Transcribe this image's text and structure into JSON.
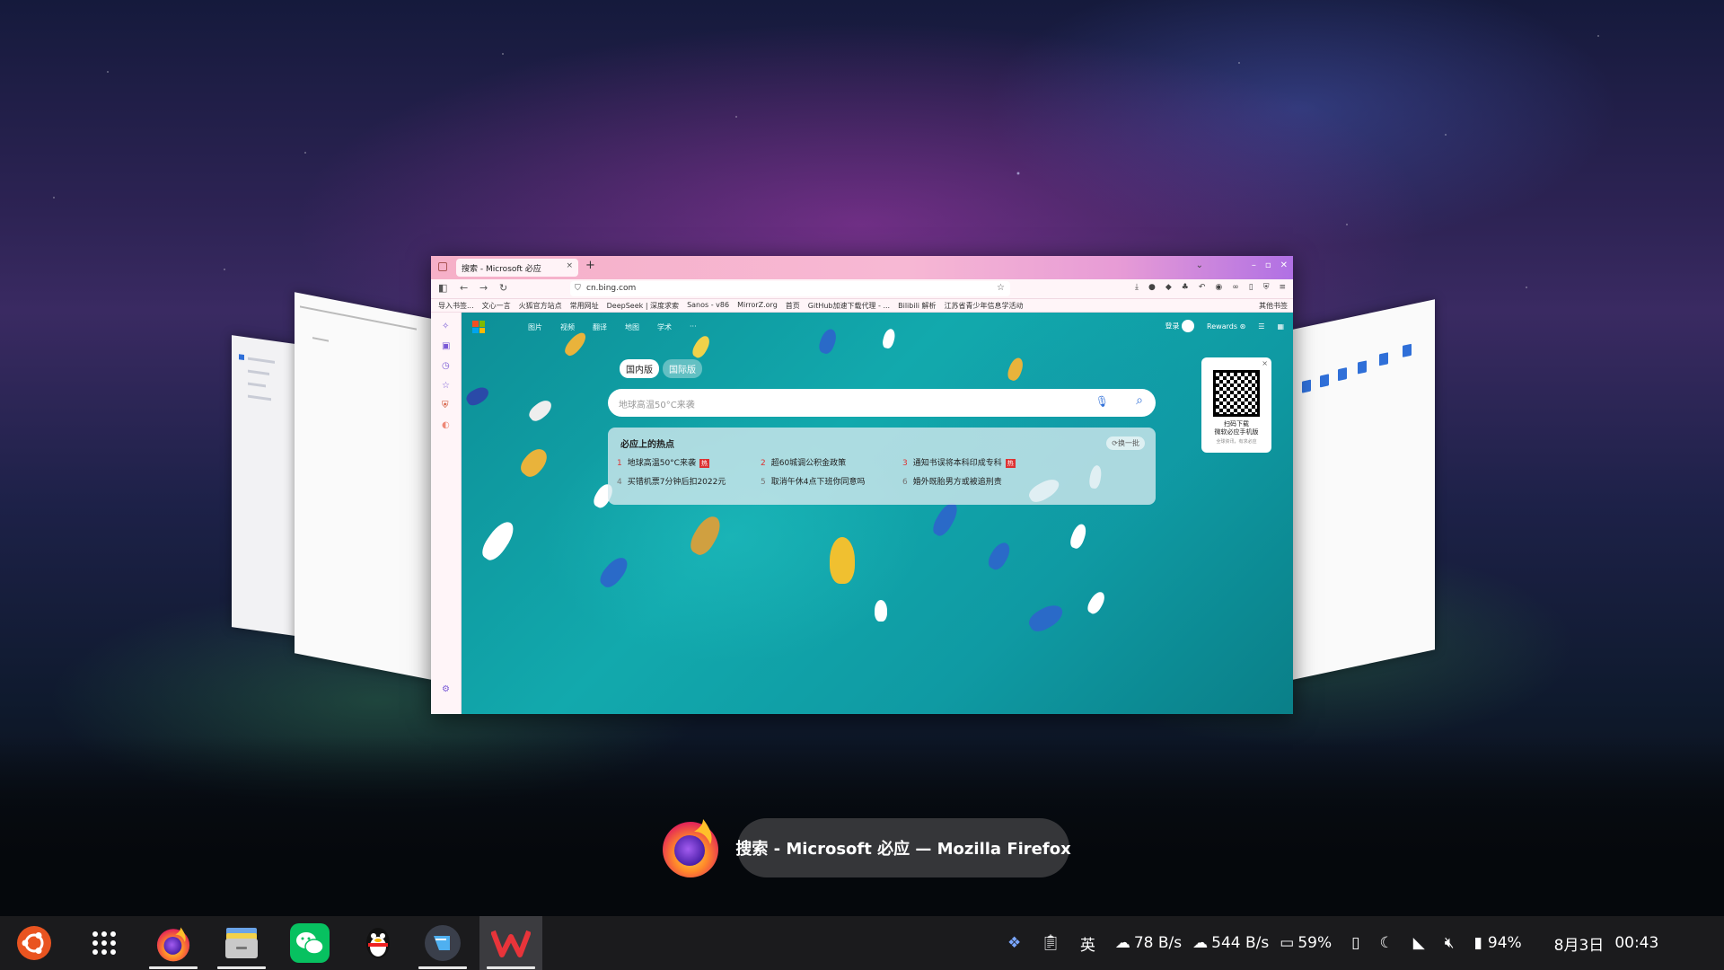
{
  "window_switcher": {
    "title": "搜索 - Microsoft 必应 — Mozilla Firefox",
    "app_icon": "firefox-icon"
  },
  "browser": {
    "tab_title": "搜索 - Microsoft 必应",
    "tab_close": "×",
    "new_tab": "+",
    "url": "cn.bing.com",
    "bookmarks": [
      "导入书签...",
      "文心一言",
      "火狐官方站点",
      "常用网址",
      "DeepSeek | 深度求索",
      "Sanos - v86",
      "MirrorZ.org",
      "首页",
      "GitHub加速下载代理 - ...",
      "Bilibili 解析",
      "江苏省青少年信息学活动"
    ],
    "other_bookmarks": "其他书签"
  },
  "bing": {
    "nav": [
      "图片",
      "视频",
      "翻译",
      "地图",
      "学术",
      "···"
    ],
    "login": "登录",
    "rewards": "Rewards",
    "tabs": [
      "国内版",
      "国际版"
    ],
    "search_placeholder": "地球高温50°C来袭",
    "hot_title": "必应上的热点",
    "refresh": "⟳换一批",
    "hot_items": [
      {
        "num": "1",
        "text": "地球高温50°C来袭",
        "badge": "热"
      },
      {
        "num": "2",
        "text": "超60城调公积金政策",
        "badge": ""
      },
      {
        "num": "3",
        "text": "通知书误将本科印成专科",
        "badge": "热"
      },
      {
        "num": "4",
        "text": "买错机票7分钟后扣2022元",
        "badge": ""
      },
      {
        "num": "5",
        "text": "取消午休4点下班你同意吗",
        "badge": ""
      },
      {
        "num": "6",
        "text": "婚外既胎男方或被追刑责",
        "badge": ""
      }
    ],
    "qr_line1": "扫码下载",
    "qr_line2": "微软必应手机版",
    "qr_line3": "全球资讯，有求必应",
    "qr_close": "×"
  },
  "taskbar": {
    "apps": [
      "ubuntu-logo",
      "app-grid",
      "firefox",
      "files",
      "wechat",
      "qq",
      "vscode-like",
      "wps"
    ],
    "input_method": "英",
    "upload_speed": "78 B/s",
    "download_speed": "544 B/s",
    "cpu": "59%",
    "battery": "94%",
    "date": "8月3日",
    "time": "00:43"
  },
  "colors": {
    "taskbar": "#1b1b1d",
    "bing_teal": "#12a9ad",
    "firefox_orange": "#ff7139"
  }
}
